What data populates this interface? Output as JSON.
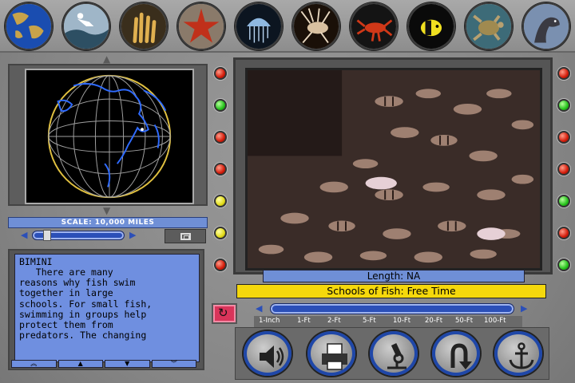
{
  "categories": [
    {
      "name": "world-map-icon",
      "bg": "#1a4db0"
    },
    {
      "name": "diver-icon",
      "bg": "#9fb6c8"
    },
    {
      "name": "coral-icon",
      "bg": "#6c5a3a"
    },
    {
      "name": "starfish-icon",
      "bg": "#8a4a3c"
    },
    {
      "name": "jellyfish-icon",
      "bg": "#101820"
    },
    {
      "name": "lionfish-icon",
      "bg": "#2a1a10"
    },
    {
      "name": "lobster-icon",
      "bg": "#181818"
    },
    {
      "name": "tropical-fish-icon",
      "bg": "#0c0c0c"
    },
    {
      "name": "sea-turtle-icon",
      "bg": "#3d6b78"
    },
    {
      "name": "sea-lion-icon",
      "bg": "#7a90b0"
    }
  ],
  "map": {
    "scale_label": "SCALE: 10,000 MILES",
    "marker_label": "BIMINI"
  },
  "article": {
    "location": "BIMINI",
    "body": "   There are many\nreasons why fish swim\ntogether in large\nschools. For small fish,\nswimming in groups help\nprotect them from\npredators. The changing"
  },
  "video": {
    "length_label": "Length: NA",
    "title": "Schools of Fish: Free Time"
  },
  "zoom_scale": {
    "labels": [
      "1-Inch",
      "1-Ft",
      "2-Ft",
      "5-Ft",
      "10-Ft",
      "20-Ft",
      "50-Ft",
      "100-Ft"
    ]
  },
  "controls": {
    "replay": "replay-icon",
    "sound": "speaker-icon",
    "print": "printer-icon",
    "microscope": "microscope-icon",
    "back": "u-turn-icon",
    "anchor": "anchor-icon"
  },
  "colors": {
    "panel_blue": "#6f8fe0",
    "title_yellow": "#f5d80c",
    "light_red": "#d41d0b",
    "light_green": "#25c21b",
    "light_yellow": "#e3dc1a"
  }
}
